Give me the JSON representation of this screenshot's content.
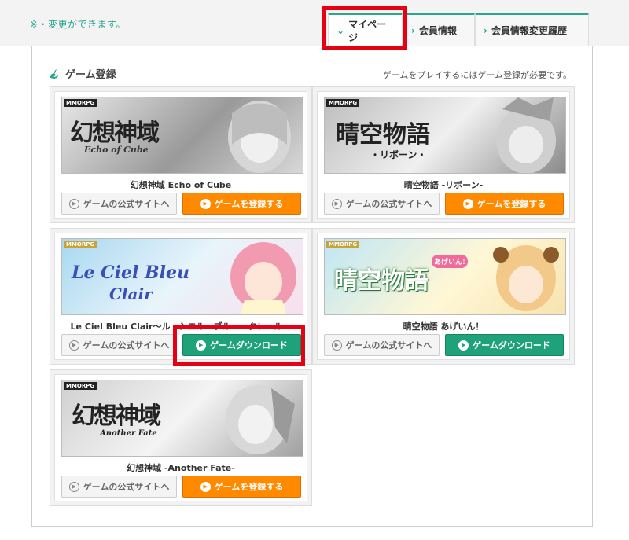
{
  "header": {
    "notice": "※・変更ができます。",
    "tabs": [
      {
        "label": "マイページ",
        "icon": "chevron-down-icon",
        "active": true
      },
      {
        "label": "会員情報",
        "icon": "chevron-right-icon",
        "active": false
      },
      {
        "label": "会員情報変更履歴",
        "icon": "chevron-right-icon",
        "active": false
      }
    ]
  },
  "section": {
    "title": "ゲーム登録",
    "note": "ゲームをプレイするにはゲーム登録が必要です。"
  },
  "colors": {
    "accent": "#2aa58e",
    "register_button": "#ff8a00",
    "download_button": "#1fa27a",
    "highlight": "#e60012"
  },
  "games": [
    {
      "genre": "MMORPG",
      "banner_logo": "幻想神域",
      "banner_sub": "Echo of Cube",
      "name": "幻想神域 Echo of Cube",
      "site_label": "ゲームの公式サイトへ",
      "action_label": "ゲームを登録する",
      "action_type": "register"
    },
    {
      "genre": "MMORPG",
      "banner_logo": "晴空物語",
      "banner_sub": "・リボーン・",
      "name": "晴空物語 -リボーン-",
      "site_label": "ゲームの公式サイトへ",
      "action_label": "ゲームを登録する",
      "action_type": "register"
    },
    {
      "genre": "MMORPG",
      "banner_logo": "Le Ciel Bleu",
      "banner_sub": "Clair",
      "name": "Le Ciel Bleu Clair〜ル・シエル・ブルー・クレール〜",
      "site_label": "ゲームの公式サイトへ",
      "action_label": "ゲームダウンロード",
      "action_type": "download"
    },
    {
      "genre": "MMORPG",
      "banner_logo": "晴空物語",
      "banner_sub": "あげいん!",
      "name": "晴空物語 あげいん！",
      "site_label": "ゲームの公式サイトへ",
      "action_label": "ゲームダウンロード",
      "action_type": "download"
    },
    {
      "genre": "MMORPG",
      "banner_logo": "幻想神域",
      "banner_sub": "Another Fate",
      "name": "幻想神域 -Another Fate-",
      "site_label": "ゲームの公式サイトへ",
      "action_label": "ゲームを登録する",
      "action_type": "register"
    }
  ]
}
